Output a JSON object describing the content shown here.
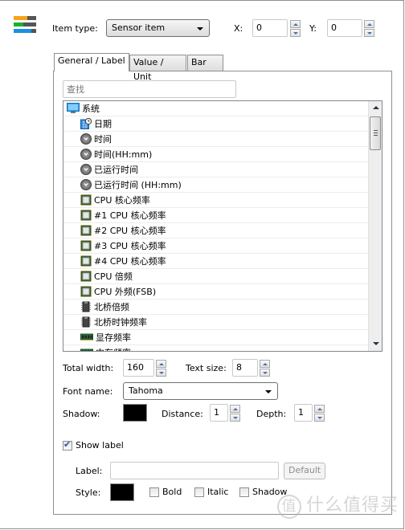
{
  "header": {
    "app_icon": "sensor-bars-icon",
    "app_icon_colors": [
      "#f5a21c",
      "#1db02c",
      "#1c8fe0"
    ],
    "item_type_label": "Item type:",
    "item_type_value": "Sensor item",
    "x_label": "X:",
    "x_value": "0",
    "y_label": "Y:",
    "y_value": "0"
  },
  "tabs": [
    {
      "label": "General / Label",
      "active": true
    },
    {
      "label": "Value / Unit",
      "active": false
    },
    {
      "label": "Bar",
      "active": false
    }
  ],
  "search": {
    "placeholder": "查找"
  },
  "sensor_list": {
    "items": [
      {
        "label": "系统",
        "icon": "computer-icon",
        "level": 0
      },
      {
        "label": "日期",
        "icon": "calendar-clock-icon",
        "level": 1
      },
      {
        "label": "时间",
        "icon": "clock-icon",
        "level": 1
      },
      {
        "label": "时间(HH:mm)",
        "icon": "clock-icon",
        "level": 1
      },
      {
        "label": "已运行时间",
        "icon": "clock-icon",
        "level": 1
      },
      {
        "label": "已运行时间 (HH:mm)",
        "icon": "clock-icon",
        "level": 1
      },
      {
        "label": "CPU 核心频率",
        "icon": "cpu-icon",
        "level": 1
      },
      {
        "label": "#1 CPU 核心频率",
        "icon": "cpu-icon",
        "level": 1
      },
      {
        "label": "#2 CPU 核心频率",
        "icon": "cpu-icon",
        "level": 1
      },
      {
        "label": "#3 CPU 核心频率",
        "icon": "cpu-icon",
        "level": 1
      },
      {
        "label": "#4 CPU 核心频率",
        "icon": "cpu-icon",
        "level": 1
      },
      {
        "label": "CPU 倍频",
        "icon": "cpu-icon",
        "level": 1
      },
      {
        "label": "CPU 外频(FSB)",
        "icon": "cpu-icon",
        "level": 1
      },
      {
        "label": "北桥倍频",
        "icon": "chip-icon",
        "level": 1
      },
      {
        "label": "北桥时钟频率",
        "icon": "chip-icon",
        "level": 1
      },
      {
        "label": "显存频率",
        "icon": "memory-icon",
        "level": 1
      },
      {
        "label": "内存频率",
        "icon": "memory-icon",
        "level": 1
      }
    ]
  },
  "settings": {
    "total_width_label": "Total width:",
    "total_width_value": "160",
    "text_size_label": "Text size:",
    "text_size_value": "8",
    "font_name_label": "Font name:",
    "font_name_value": "Tahoma",
    "shadow_label": "Shadow:",
    "shadow_color": "#000000",
    "distance_label": "Distance:",
    "distance_value": "1",
    "depth_label": "Depth:",
    "depth_value": "1"
  },
  "label_section": {
    "show_label_text": "Show label",
    "show_label_checked": true,
    "label_label": "Label:",
    "label_value": "",
    "default_button": "Default",
    "style_label": "Style:",
    "style_color": "#000000",
    "bold_label": "Bold",
    "bold_checked": false,
    "italic_label": "Italic",
    "italic_checked": false,
    "shadow_label": "Shadow",
    "shadow_checked": false
  },
  "watermark": {
    "circle_char": "值",
    "text": "什么值得买"
  }
}
